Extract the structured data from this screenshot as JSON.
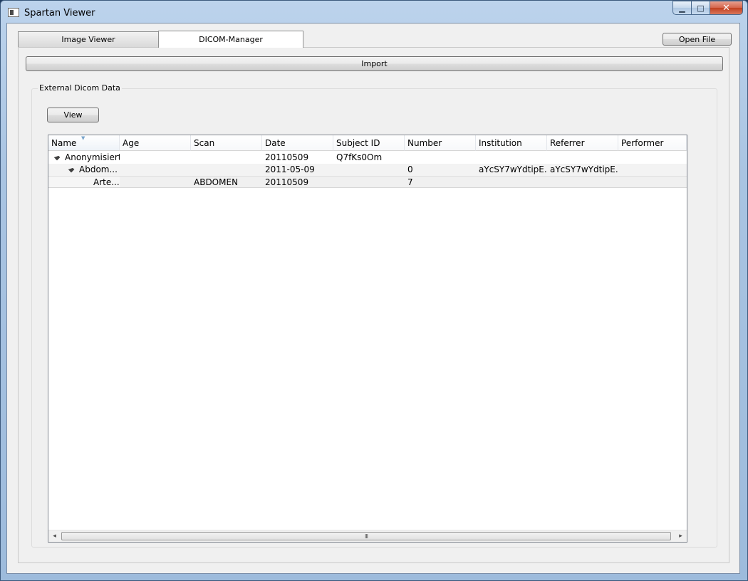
{
  "window": {
    "title": "Spartan Viewer",
    "minimize_glyph": "▁",
    "maximize_glyph": "□",
    "close_glyph": "✕"
  },
  "tabs": [
    {
      "label": "Image Viewer",
      "active": false
    },
    {
      "label": "DICOM-Manager",
      "active": true
    }
  ],
  "toolbar": {
    "open_file_label": "Open File"
  },
  "dicom_manager": {
    "import_label": "Import",
    "group_title": "External Dicom Data",
    "view_label": "View",
    "columns": [
      "Name",
      "Age",
      "Scan",
      "Date",
      "Subject ID",
      "Number",
      "Institution",
      "Referrer",
      "Performer"
    ],
    "sorted_column": "Name",
    "rows": [
      {
        "level": 0,
        "expanded": true,
        "name": "Anonymisiert",
        "age": "",
        "scan": "",
        "date": "20110509",
        "subject_id": "Q7fKs0Om",
        "number": "",
        "institution": "",
        "referrer": "",
        "performer": ""
      },
      {
        "level": 1,
        "expanded": true,
        "name": "Abdom...",
        "age": "",
        "scan": "",
        "date": "2011-05-09",
        "subject_id": "",
        "number": "0",
        "institution": "aYcSY7wYdtipE...",
        "referrer": "aYcSY7wYdtipE...",
        "performer": ""
      },
      {
        "level": 2,
        "expanded": false,
        "name": "Arte...",
        "age": "",
        "scan": "ABDOMEN",
        "date": "20110509",
        "subject_id": "",
        "number": "7",
        "institution": "",
        "referrer": "",
        "performer": ""
      }
    ],
    "scroll_left_glyph": "◂",
    "scroll_right_glyph": "▸",
    "scroll_grip": "III"
  },
  "colors": {
    "titlebar": "#a9c4e2",
    "client_bg": "#f0f0f0",
    "close_button": "#c2401f"
  }
}
